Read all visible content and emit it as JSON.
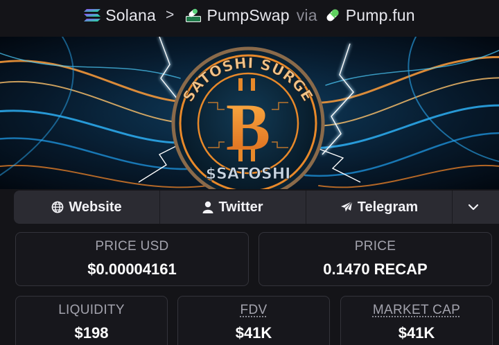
{
  "breadcrumb": {
    "chain": "Solana",
    "separator": ">",
    "dex": "PumpSwap",
    "via": "via",
    "launchpad": "Pump.fun"
  },
  "banner": {
    "title_arc": "SATOSHI SURGE",
    "ticker": "$SATOSHI",
    "coin_symbol": "B"
  },
  "links": {
    "website": "Website",
    "twitter": "Twitter",
    "telegram": "Telegram"
  },
  "stats": {
    "price_usd": {
      "label": "PRICE USD",
      "value": "$0.00004161"
    },
    "price": {
      "label": "PRICE",
      "value": "0.1470 RECAP"
    },
    "liquidity": {
      "label": "LIQUIDITY",
      "value": "$198"
    },
    "fdv": {
      "label": "FDV",
      "value": "$41K"
    },
    "market_cap": {
      "label": "MARKET CAP",
      "value": "$41K"
    }
  },
  "colors": {
    "background": "#141418",
    "card_border": "#34343b",
    "button_bg": "#2b2b32",
    "coin_orange": "#e8892a",
    "electric_blue": "#32b6ff"
  },
  "icons": [
    "solana-icon",
    "pumpswap-icon",
    "pill-icon",
    "globe-icon",
    "user-icon",
    "paper-plane-icon",
    "chevron-down-icon"
  ]
}
